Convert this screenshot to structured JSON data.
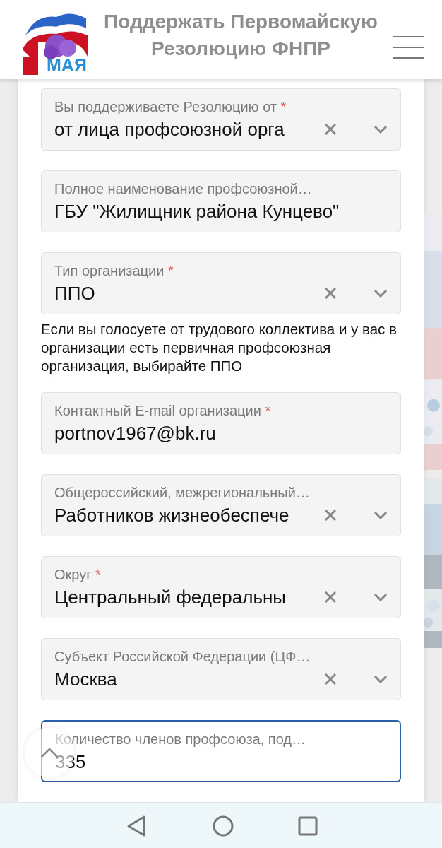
{
  "title": "Поддержать Первомайскую Резолюцию ФНПР",
  "fields": [
    {
      "kind": "select",
      "label": "Вы поддерживаете Резолюцию от",
      "required": true,
      "value": "от лица профсоюзной орга",
      "focused": false
    },
    {
      "kind": "text",
      "label": "Полное наименование профсоюзной…",
      "required": false,
      "value": "ГБУ \"Жилищник района Кунцево\"",
      "focused": false
    },
    {
      "kind": "select",
      "label": "Тип организации",
      "required": true,
      "value": "ППО",
      "focused": false
    },
    {
      "kind": "hint",
      "text": "Если вы голосуете от трудового коллектива и у вас в организации есть первичная профсоюзная организация, выбирайте ППО"
    },
    {
      "kind": "text",
      "label": "Контактный E-mail организации",
      "required": true,
      "value": "portnov1967@bk.ru",
      "focused": false
    },
    {
      "kind": "select",
      "label": "Общероссийский, межрегиональный…",
      "required": false,
      "value": "Работников жизнеобеспече",
      "focused": false
    },
    {
      "kind": "select",
      "label": "Округ",
      "required": true,
      "value": "Центральный федеральны",
      "focused": false
    },
    {
      "kind": "select",
      "label": "Субъект Российской Федерации (ЦФ…",
      "required": false,
      "value": "Москва",
      "focused": false
    },
    {
      "kind": "text",
      "label": "Количество членов профсоюза, под…",
      "required": false,
      "value": "335",
      "focused": true
    }
  ],
  "required_mark": "*",
  "logo": {
    "text": "МАЯ"
  }
}
